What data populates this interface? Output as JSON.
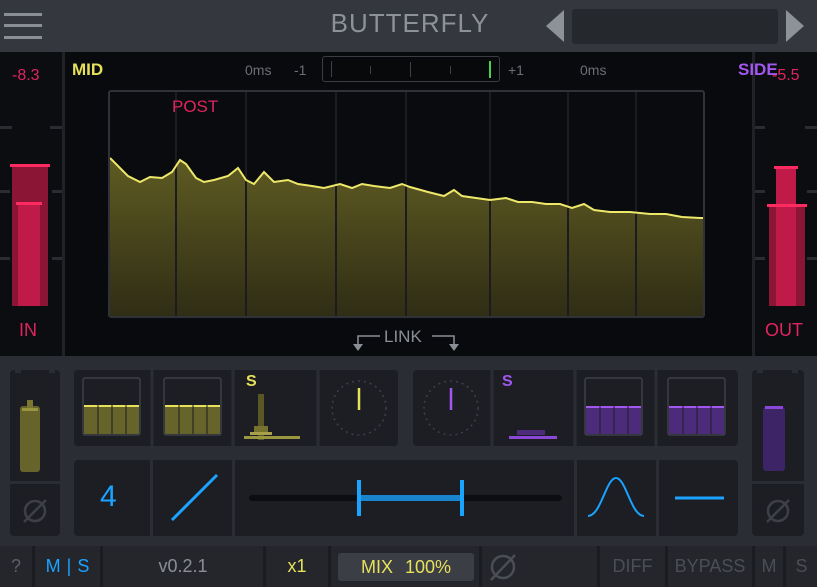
{
  "header": {
    "title": "BUTTERFLY",
    "preset_name": ""
  },
  "display": {
    "in_level": "-8.3",
    "out_level": "-5.5",
    "in_label": "IN",
    "out_label": "OUT",
    "mid_label": "MID",
    "side_label": "SIDE",
    "post_label": "POST",
    "delay_left": "0ms",
    "delay_right": "0ms",
    "corr_min": "-1",
    "corr_max": "+1",
    "link_label": "LINK"
  },
  "controls": {
    "mid_solo": "S",
    "side_solo": "S",
    "order_value": "4"
  },
  "footer": {
    "help": "?",
    "mode_m": "M",
    "mode_sep": "|",
    "mode_s": "S",
    "version": "v0.2.1",
    "oversample": "x1",
    "mix_label": "MIX",
    "mix_value": "100%",
    "diff": "DIFF",
    "bypass": "BYPASS",
    "m": "M",
    "s": "S"
  },
  "colors": {
    "mid": "#e6e05a",
    "side": "#a257f0",
    "meter_red": "#e0245e",
    "accent_blue": "#1aa3ff"
  },
  "icons": {
    "menu": "hamburger-icon",
    "prev": "triangle-left-icon",
    "next": "triangle-right-icon",
    "phase": "phase-invert-icon",
    "bell": "bell-curve-icon",
    "line": "flat-line-icon",
    "slope": "diagonal-line-icon"
  }
}
